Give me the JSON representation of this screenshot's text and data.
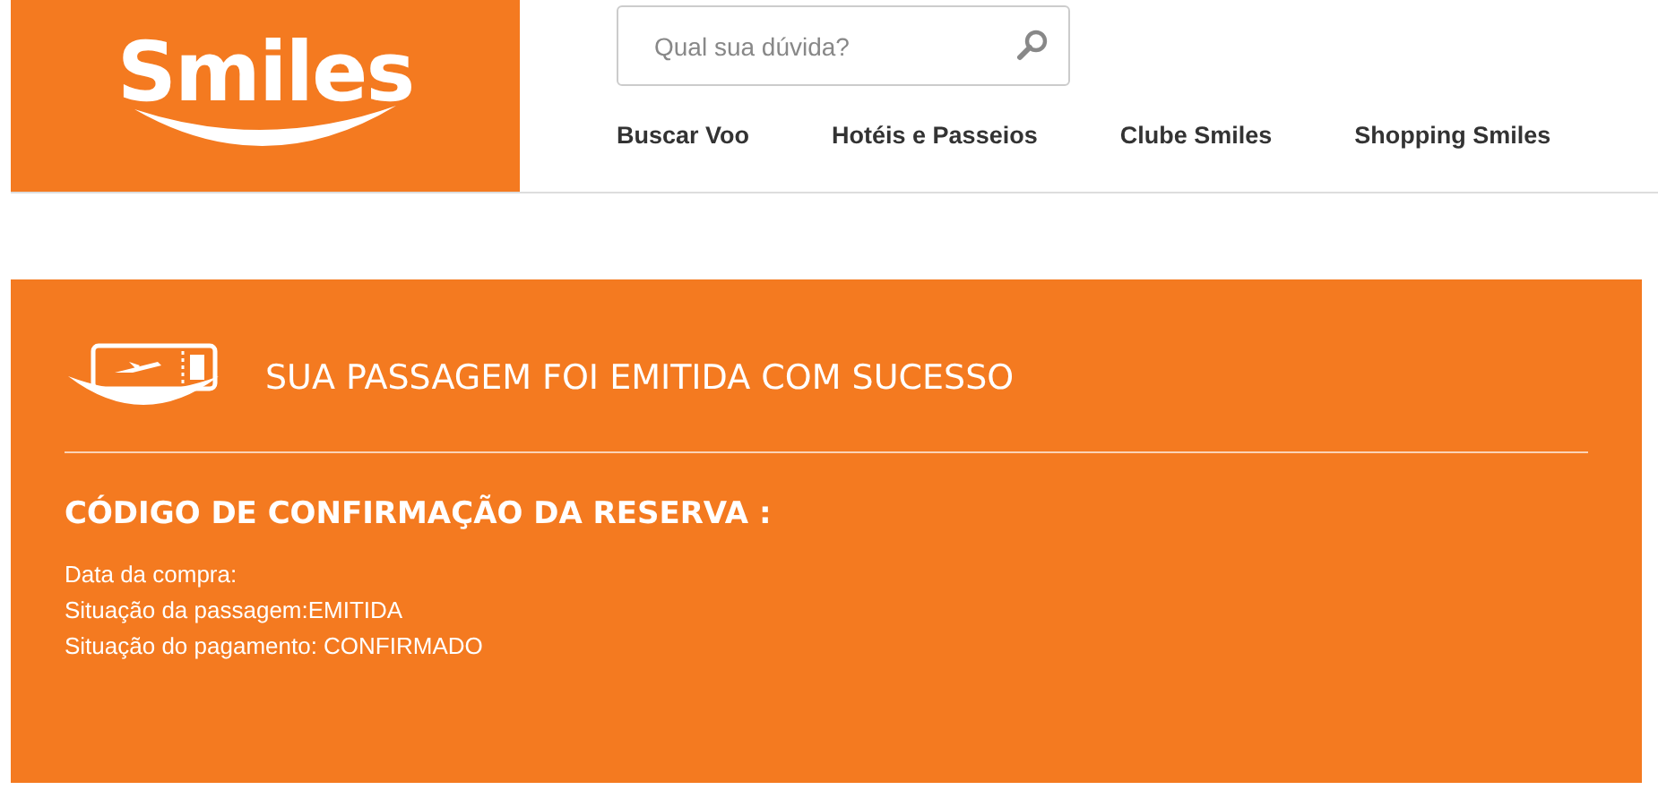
{
  "header": {
    "logo": "Smiles",
    "search": {
      "placeholder": "Qual sua dúvida?"
    },
    "nav": [
      {
        "label": "Buscar Voo"
      },
      {
        "label": "Hotéis e Passeios"
      },
      {
        "label": "Clube Smiles"
      },
      {
        "label": "Shopping Smiles"
      }
    ]
  },
  "confirmation": {
    "title": "SUA PASSAGEM FOI EMITIDA COM SUCESSO",
    "code_heading": "CÓDIGO DE CONFIRMAÇÃO DA RESERVA :",
    "details": [
      "Data da compra:",
      "Situação da passagem:EMITIDA",
      "Situação do pagamento: CONFIRMADO"
    ]
  }
}
